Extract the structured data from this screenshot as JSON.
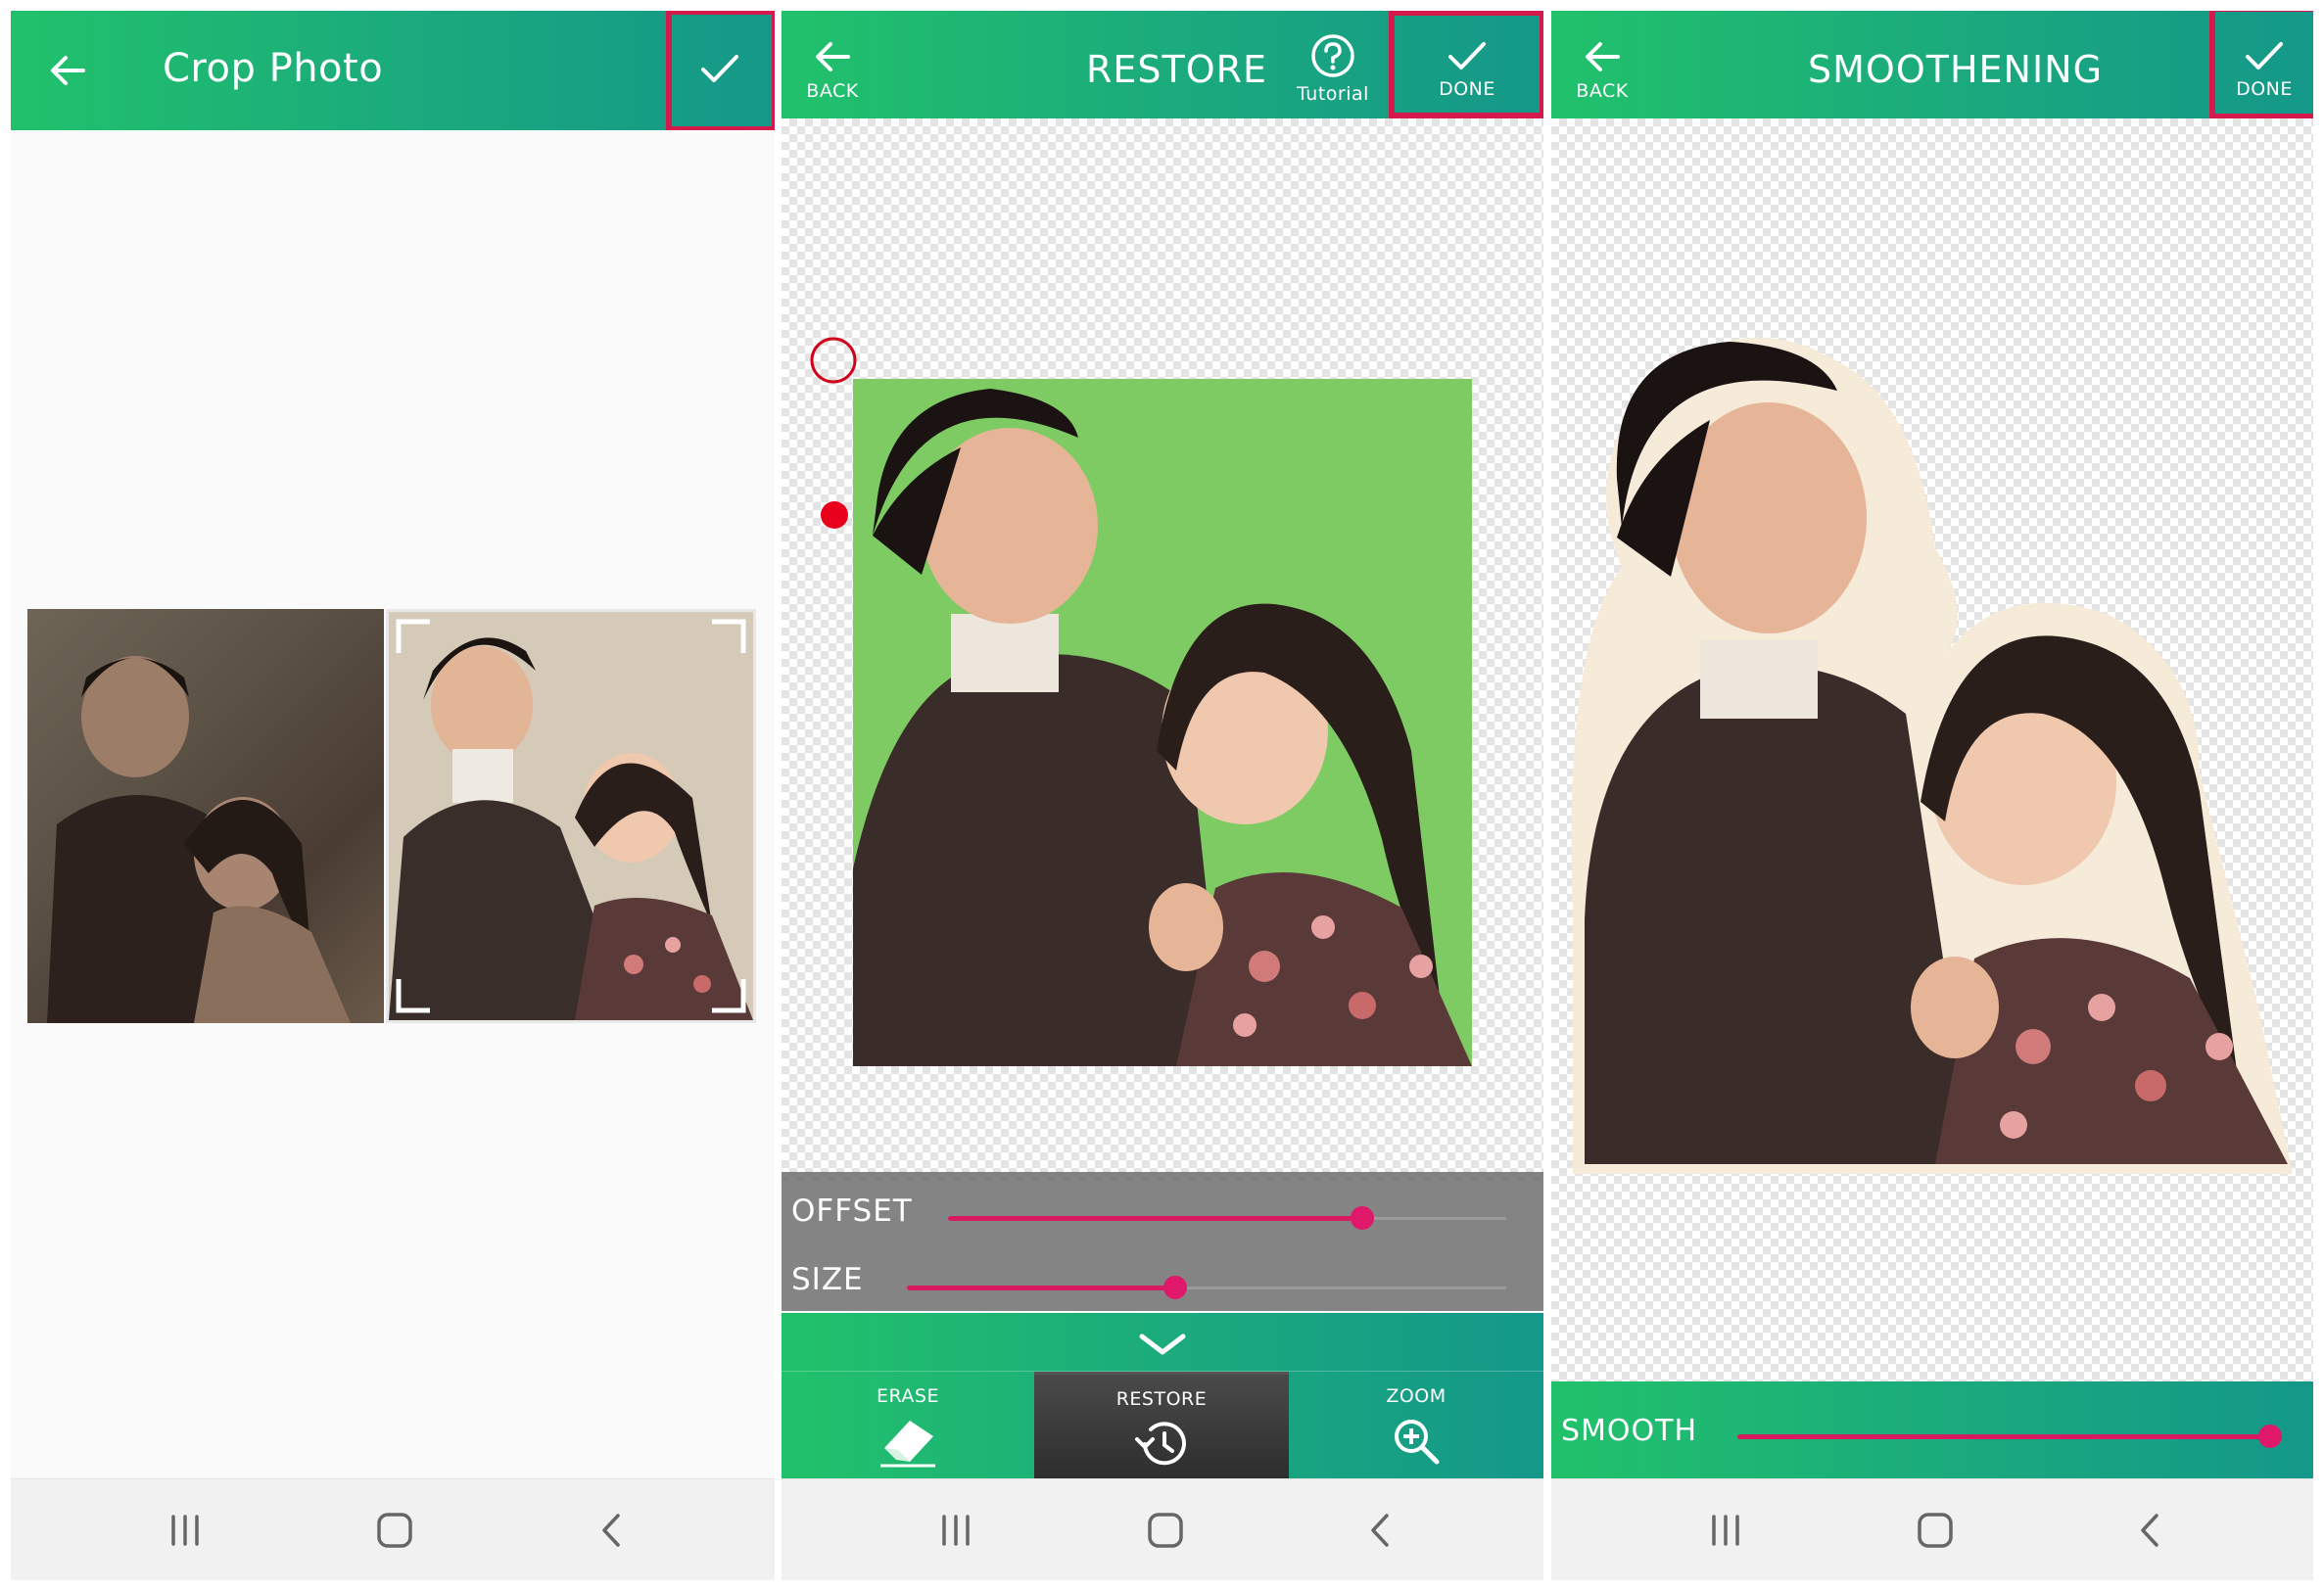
{
  "panel_crop": {
    "title": "Crop Photo",
    "back_icon": "arrow-left-icon",
    "confirm_icon": "check-icon"
  },
  "panel_restore": {
    "title": "RESTORE",
    "back_label": "BACK",
    "tutorial_label": "Tutorial",
    "done_label": "DONE",
    "sliders": [
      {
        "label": "OFFSET",
        "value": 0.75
      },
      {
        "label": "SIZE",
        "value": 0.45
      }
    ],
    "tools": [
      {
        "label": "ERASE",
        "icon": "eraser-icon",
        "active": false
      },
      {
        "label": "RESTORE",
        "icon": "restore-history-icon",
        "active": true
      },
      {
        "label": "ZOOM",
        "icon": "zoom-in-icon",
        "active": false
      }
    ]
  },
  "panel_smooth": {
    "title": "SMOOTHENING",
    "back_label": "BACK",
    "done_label": "DONE",
    "slider": {
      "label": "SMOOTH",
      "value": 1.0
    }
  },
  "colors": {
    "accent_green": "#21c16b",
    "accent_teal": "#149889",
    "highlight": "#d4194c",
    "slider": "#d81b60"
  }
}
